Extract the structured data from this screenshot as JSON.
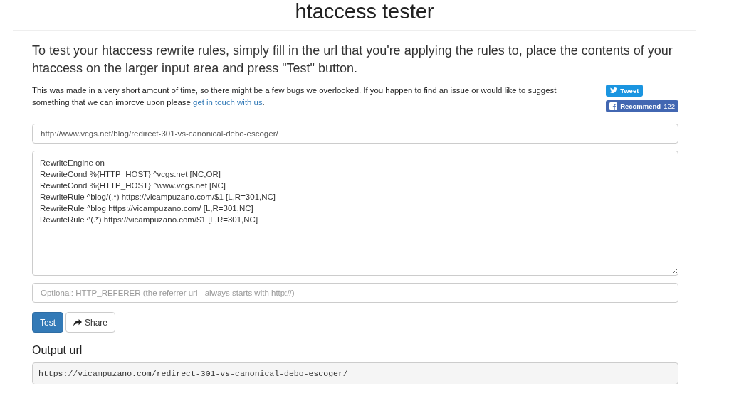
{
  "title": "htaccess tester",
  "intro": "To test your htaccess rewrite rules, simply fill in the url that you're applying the rules to, place the contents of your htaccess on the larger input area and press \"Test\" button.",
  "notice": {
    "text": "This was made in a very short amount of time, so there might be a few bugs we overlooked. If you happen to find an issue or would like to suggest something that we can improve upon please ",
    "link": "get in touch with us",
    "after": "."
  },
  "social": {
    "tweet": "Tweet",
    "recommend": "Recommend",
    "recommend_count": "122"
  },
  "url_field": {
    "value": "http://www.vcgs.net/blog/redirect-301-vs-canonical-debo-escoger/"
  },
  "rules_field": {
    "lines": [
      "RewriteEngine on",
      "RewriteCond %{HTTP_HOST} ^vcgs.net [NC,OR]",
      "RewriteCond %{HTTP_HOST} ^www.vcgs.net [NC]",
      "RewriteRule ^blog/(.*) https://vicampuzano.com/$1 [L,R=301,NC]",
      "RewriteRule ^blog https://vicampuzano.com/ [L,R=301,NC]",
      "RewriteRule ^(.*) https://vicampuzano.com/$1 [L,R=301,NC]"
    ]
  },
  "referer_field": {
    "placeholder": "Optional: HTTP_REFERER (the referrer url - always starts with http://)"
  },
  "buttons": {
    "test": "Test",
    "share": "Share"
  },
  "output": {
    "heading": "Output url",
    "value": "https://vicampuzano.com/redirect-301-vs-canonical-debo-escoger/"
  }
}
